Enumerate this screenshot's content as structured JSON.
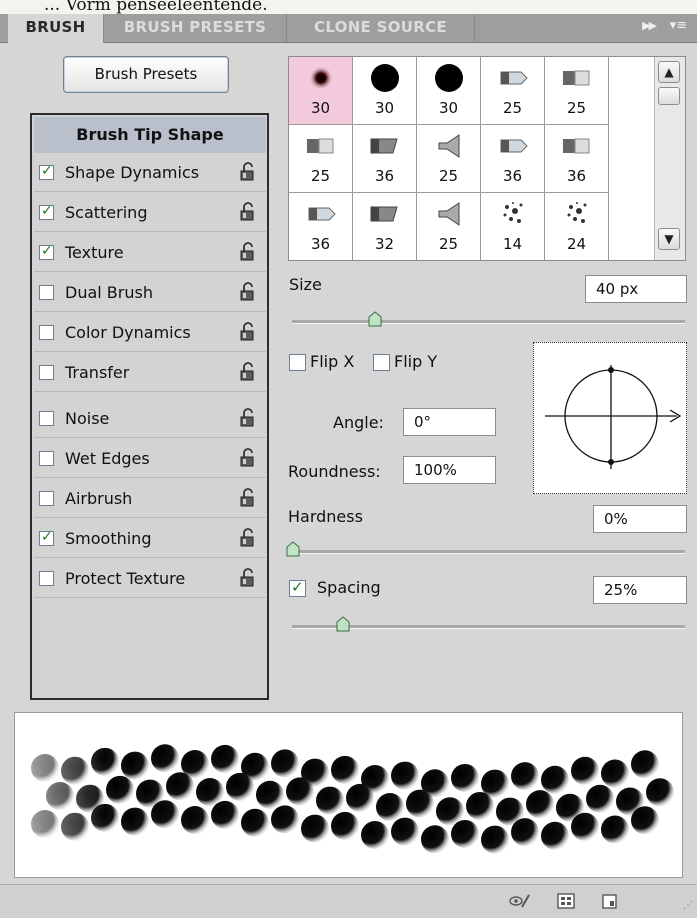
{
  "caption": "... Vorm penseeleentende.",
  "tabs": [
    {
      "label": "BRUSH",
      "active": true
    },
    {
      "label": "BRUSH PRESETS",
      "active": false
    },
    {
      "label": "CLONE SOURCE",
      "active": false
    }
  ],
  "tab_icons": {
    "collapse": "double-chevron-right-icon",
    "menu": "panel-menu-icon"
  },
  "preset_button": "Brush Presets",
  "tip_shape_label": "Brush Tip Shape",
  "options": [
    {
      "label": "Shape Dynamics",
      "checked": true
    },
    {
      "label": "Scattering",
      "checked": true
    },
    {
      "label": "Texture",
      "checked": true
    },
    {
      "label": "Dual Brush",
      "checked": false
    },
    {
      "label": "Color Dynamics",
      "checked": false
    },
    {
      "label": "Transfer",
      "checked": false
    },
    {
      "label": "Noise",
      "checked": false
    },
    {
      "label": "Wet Edges",
      "checked": false
    },
    {
      "label": "Airbrush",
      "checked": false
    },
    {
      "label": "Smoothing",
      "checked": true
    },
    {
      "label": "Protect Texture",
      "checked": false
    }
  ],
  "tips": [
    {
      "size": "30",
      "shape": "soft",
      "selected": true
    },
    {
      "size": "30",
      "shape": "hard"
    },
    {
      "size": "30",
      "shape": "hard"
    },
    {
      "size": "25",
      "shape": "pencil"
    },
    {
      "size": "25",
      "shape": "flat"
    },
    {
      "size": "25",
      "shape": "flat"
    },
    {
      "size": "36",
      "shape": "angled"
    },
    {
      "size": "25",
      "shape": "fan"
    },
    {
      "size": "36",
      "shape": "pencil"
    },
    {
      "size": "36",
      "shape": "flat"
    },
    {
      "size": "36",
      "shape": "pencil"
    },
    {
      "size": "32",
      "shape": "angled"
    },
    {
      "size": "25",
      "shape": "fan"
    },
    {
      "size": "14",
      "shape": "scatter"
    },
    {
      "size": "24",
      "shape": "scatter"
    }
  ],
  "size": {
    "label": "Size",
    "value": "40 px",
    "slider_fraction": 0.2
  },
  "flip": {
    "x_label": "Flip X",
    "y_label": "Flip Y",
    "x_checked": false,
    "y_checked": false
  },
  "angle": {
    "label": "Angle:",
    "value": "0°"
  },
  "roundness": {
    "label": "Roundness:",
    "value": "100%"
  },
  "hardness": {
    "label": "Hardness",
    "value": "0%",
    "slider_fraction": 0.0
  },
  "spacing": {
    "label": "Spacing",
    "value": "25%",
    "checked": true,
    "slider_fraction": 0.12
  },
  "status_icons": [
    "eye-brush-icon",
    "grid-panel-icon",
    "new-preset-icon"
  ]
}
